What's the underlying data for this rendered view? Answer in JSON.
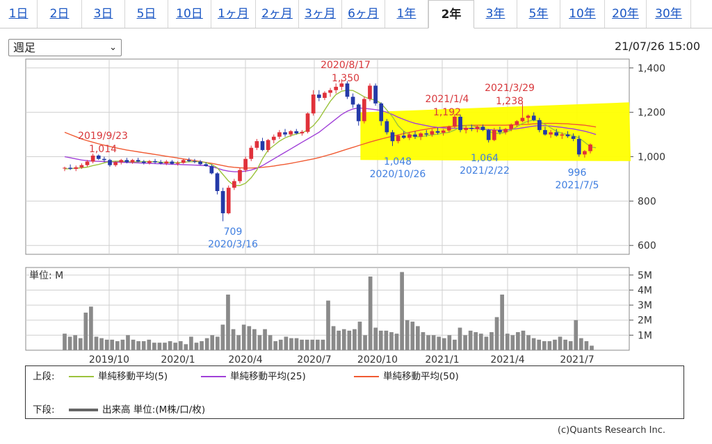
{
  "tabs": [
    {
      "label": "1日",
      "active": false
    },
    {
      "label": "2日",
      "active": false
    },
    {
      "label": "3日",
      "active": false
    },
    {
      "label": "5日",
      "active": false
    },
    {
      "label": "10日",
      "active": false
    },
    {
      "label": "1ヶ月",
      "active": false
    },
    {
      "label": "2ヶ月",
      "active": false
    },
    {
      "label": "3ヶ月",
      "active": false
    },
    {
      "label": "6ヶ月",
      "active": false
    },
    {
      "label": "1年",
      "active": false
    },
    {
      "label": "2年",
      "active": true
    },
    {
      "label": "3年",
      "active": false
    },
    {
      "label": "5年",
      "active": false
    },
    {
      "label": "10年",
      "active": false
    },
    {
      "label": "20年",
      "active": false
    },
    {
      "label": "30年",
      "active": false
    }
  ],
  "period_select": {
    "value": "週足"
  },
  "timestamp": "21/07/26 15:00",
  "colors": {
    "up": "#e0313a",
    "down": "#243aa8",
    "ma5": "#9cc33c",
    "ma25": "#a040d8",
    "ma50": "#f05a32",
    "volume": "#8a8a8a",
    "highlight": "#ffff00",
    "red_annotation": "#d8373b",
    "blue_annotation": "#3f7ee0",
    "tab_link": "#1a56c4"
  },
  "chart_data": [
    {
      "type": "candlestick",
      "title": "",
      "y_ticks": [
        "1,400",
        "1,200",
        "1,000",
        "800",
        "600"
      ],
      "ylim": [
        560,
        1440
      ],
      "x_ticks": [
        "2019/10",
        "2020/1",
        "2020/4",
        "2020/7",
        "2020/10",
        "2021/1",
        "2021/4",
        "2021/7"
      ],
      "y_axis_side": "right",
      "grid": true,
      "highlight_region": {
        "x_from": "2020/9",
        "x_to": "2021/7",
        "y_from": 980,
        "y_to": 1245
      },
      "annotations_red": [
        {
          "date": "2019/9/23",
          "value": "1,014"
        },
        {
          "date": "2020/8/17",
          "value": "1,350"
        },
        {
          "date": "2021/1/4",
          "value": "1,192"
        },
        {
          "date": "2021/3/29",
          "value": "1,238"
        }
      ],
      "annotations_blue": [
        {
          "date": "2020/3/16",
          "value": "709"
        },
        {
          "date": "2020/10/26",
          "value": "1,048"
        },
        {
          "date": "2021/2/22",
          "value": "1,064"
        },
        {
          "date": "2021/7/5",
          "value": "996"
        }
      ],
      "candles": [
        [
          948,
          955,
          935,
          950
        ],
        [
          950,
          965,
          940,
          945
        ],
        [
          945,
          960,
          935,
          952
        ],
        [
          952,
          970,
          945,
          962
        ],
        [
          962,
          985,
          955,
          978
        ],
        [
          978,
          1014,
          970,
          1005
        ],
        [
          1005,
          1010,
          985,
          990
        ],
        [
          990,
          1000,
          975,
          985
        ],
        [
          985,
          990,
          955,
          962
        ],
        [
          962,
          980,
          955,
          975
        ],
        [
          975,
          990,
          965,
          985
        ],
        [
          985,
          995,
          970,
          975
        ],
        [
          975,
          990,
          968,
          985
        ],
        [
          985,
          995,
          975,
          978
        ],
        [
          978,
          985,
          965,
          972
        ],
        [
          972,
          985,
          965,
          980
        ],
        [
          980,
          990,
          968,
          975
        ],
        [
          975,
          985,
          965,
          970
        ],
        [
          970,
          985,
          962,
          978
        ],
        [
          978,
          985,
          965,
          968
        ],
        [
          968,
          980,
          960,
          972
        ],
        [
          972,
          990,
          968,
          985
        ],
        [
          985,
          995,
          975,
          980
        ],
        [
          980,
          990,
          970,
          978
        ],
        [
          978,
          985,
          962,
          966
        ],
        [
          966,
          975,
          955,
          958
        ],
        [
          958,
          965,
          920,
          925
        ],
        [
          925,
          930,
          830,
          845
        ],
        [
          845,
          860,
          709,
          745
        ],
        [
          745,
          870,
          740,
          860
        ],
        [
          860,
          900,
          850,
          890
        ],
        [
          890,
          950,
          880,
          940
        ],
        [
          940,
          1000,
          930,
          990
        ],
        [
          990,
          1050,
          980,
          1040
        ],
        [
          1040,
          1080,
          1030,
          1070
        ],
        [
          1070,
          1085,
          1025,
          1030
        ],
        [
          1030,
          1080,
          1020,
          1075
        ],
        [
          1075,
          1100,
          1060,
          1090
        ],
        [
          1090,
          1120,
          1080,
          1110
        ],
        [
          1110,
          1125,
          1090,
          1100
        ],
        [
          1100,
          1120,
          1090,
          1115
        ],
        [
          1115,
          1125,
          1100,
          1105
        ],
        [
          1105,
          1120,
          1095,
          1112
        ],
        [
          1112,
          1200,
          1105,
          1195
        ],
        [
          1195,
          1300,
          1185,
          1280
        ],
        [
          1280,
          1300,
          1250,
          1265
        ],
        [
          1265,
          1295,
          1255,
          1288
        ],
        [
          1288,
          1310,
          1270,
          1300
        ],
        [
          1300,
          1330,
          1285,
          1315
        ],
        [
          1315,
          1350,
          1300,
          1330
        ],
        [
          1330,
          1340,
          1260,
          1270
        ],
        [
          1270,
          1285,
          1220,
          1235
        ],
        [
          1235,
          1240,
          1140,
          1160
        ],
        [
          1160,
          1270,
          1150,
          1260
        ],
        [
          1260,
          1330,
          1250,
          1320
        ],
        [
          1320,
          1330,
          1230,
          1240
        ],
        [
          1240,
          1245,
          1140,
          1160
        ],
        [
          1160,
          1170,
          1100,
          1110
        ],
        [
          1110,
          1120,
          1048,
          1070
        ],
        [
          1070,
          1100,
          1060,
          1095
        ],
        [
          1095,
          1115,
          1080,
          1085
        ],
        [
          1085,
          1110,
          1075,
          1100
        ],
        [
          1100,
          1115,
          1080,
          1090
        ],
        [
          1090,
          1110,
          1075,
          1105
        ],
        [
          1105,
          1120,
          1090,
          1100
        ],
        [
          1100,
          1125,
          1090,
          1115
        ],
        [
          1115,
          1130,
          1100,
          1108
        ],
        [
          1108,
          1125,
          1095,
          1118
        ],
        [
          1118,
          1140,
          1110,
          1135
        ],
        [
          1135,
          1192,
          1130,
          1180
        ],
        [
          1180,
          1190,
          1110,
          1120
        ],
        [
          1120,
          1140,
          1105,
          1130
        ],
        [
          1130,
          1145,
          1115,
          1125
        ],
        [
          1125,
          1140,
          1110,
          1135
        ],
        [
          1135,
          1145,
          1115,
          1120
        ],
        [
          1120,
          1125,
          1064,
          1075
        ],
        [
          1075,
          1130,
          1070,
          1120
        ],
        [
          1120,
          1135,
          1100,
          1110
        ],
        [
          1110,
          1130,
          1100,
          1125
        ],
        [
          1125,
          1150,
          1115,
          1145
        ],
        [
          1145,
          1165,
          1135,
          1160
        ],
        [
          1160,
          1238,
          1155,
          1175
        ],
        [
          1175,
          1190,
          1150,
          1185
        ],
        [
          1185,
          1200,
          1160,
          1165
        ],
        [
          1165,
          1175,
          1110,
          1120
        ],
        [
          1120,
          1135,
          1095,
          1100
        ],
        [
          1100,
          1120,
          1085,
          1110
        ],
        [
          1110,
          1125,
          1090,
          1095
        ],
        [
          1095,
          1110,
          1080,
          1100
        ],
        [
          1100,
          1115,
          1085,
          1092
        ],
        [
          1092,
          1105,
          1070,
          1080
        ],
        [
          1080,
          1095,
          1000,
          1010
        ],
        [
          1010,
          1030,
          996,
          1025
        ],
        [
          1025,
          1060,
          1015,
          1055
        ]
      ],
      "ma5": [
        945,
        946,
        948,
        950,
        953,
        960,
        965,
        972,
        978,
        980,
        980,
        978,
        976,
        977,
        978,
        978,
        977,
        975,
        974,
        974,
        973,
        975,
        977,
        978,
        977,
        973,
        965,
        950,
        920,
        890,
        870,
        870,
        880,
        905,
        940,
        990,
        1030,
        1050,
        1070,
        1085,
        1095,
        1102,
        1108,
        1120,
        1140,
        1170,
        1210,
        1250,
        1280,
        1295,
        1300,
        1298,
        1285,
        1270,
        1260,
        1255,
        1240,
        1210,
        1180,
        1140,
        1115,
        1100,
        1090,
        1090,
        1095,
        1098,
        1102,
        1106,
        1110,
        1120,
        1135,
        1140,
        1140,
        1135,
        1130,
        1115,
        1105,
        1105,
        1110,
        1120,
        1135,
        1150,
        1160,
        1165,
        1160,
        1145,
        1130,
        1115,
        1105,
        1100,
        1095,
        1085,
        1065,
        1045,
        1040
      ],
      "ma25": [
        1000,
        995,
        990,
        985,
        982,
        980,
        979,
        978,
        977,
        976,
        975,
        974,
        973,
        972,
        971,
        970,
        969,
        968,
        967,
        966,
        965,
        964,
        963,
        962,
        961,
        960,
        955,
        948,
        940,
        935,
        932,
        932,
        935,
        940,
        948,
        960,
        975,
        990,
        1005,
        1020,
        1035,
        1050,
        1065,
        1080,
        1095,
        1110,
        1130,
        1150,
        1170,
        1190,
        1205,
        1215,
        1220,
        1218,
        1215,
        1212,
        1208,
        1200,
        1190,
        1178,
        1168,
        1158,
        1150,
        1145,
        1140,
        1135,
        1132,
        1130,
        1128,
        1128,
        1128,
        1128,
        1127,
        1126,
        1124,
        1122,
        1120,
        1120,
        1121,
        1123,
        1126,
        1130,
        1134,
        1138,
        1140,
        1140,
        1138,
        1135,
        1132,
        1128,
        1125,
        1120,
        1115,
        1108,
        1100
      ],
      "ma50": [
        1110,
        1100,
        1090,
        1080,
        1072,
        1065,
        1058,
        1052,
        1046,
        1040,
        1035,
        1030,
        1026,
        1022,
        1018,
        1014,
        1010,
        1006,
        1002,
        998,
        994,
        990,
        986,
        982,
        978,
        974,
        970,
        965,
        960,
        955,
        952,
        950,
        949,
        949,
        950,
        952,
        955,
        958,
        962,
        966,
        970,
        975,
        980,
        985,
        990,
        996,
        1003,
        1010,
        1018,
        1026,
        1034,
        1042,
        1050,
        1058,
        1066,
        1073,
        1080,
        1086,
        1092,
        1098,
        1104,
        1110,
        1115,
        1120,
        1124,
        1128,
        1131,
        1134,
        1136,
        1138,
        1140,
        1141,
        1142,
        1142,
        1142,
        1142,
        1142,
        1142,
        1142,
        1143,
        1144,
        1145,
        1146,
        1148,
        1149,
        1150,
        1150,
        1150,
        1149,
        1148,
        1146,
        1144,
        1142,
        1138,
        1134
      ]
    },
    {
      "type": "bar",
      "title": "",
      "unit_label": "単位: M",
      "y_ticks": [
        "5M",
        "4M",
        "3M",
        "2M",
        "1M"
      ],
      "ylim": [
        0,
        5.5
      ],
      "x_ticks": [
        "2019/10",
        "2020/1",
        "2020/4",
        "2020/7",
        "2020/10",
        "2021/1",
        "2021/4",
        "2021/7"
      ],
      "values": [
        1.1,
        0.9,
        1.0,
        0.8,
        2.5,
        2.9,
        0.9,
        0.8,
        0.7,
        0.7,
        0.6,
        0.7,
        1.0,
        0.7,
        0.6,
        0.6,
        0.7,
        0.5,
        0.5,
        0.5,
        0.6,
        0.5,
        0.6,
        0.4,
        0.9,
        0.5,
        0.6,
        0.8,
        1.0,
        0.9,
        1.7,
        3.7,
        1.4,
        1.0,
        1.7,
        1.6,
        1.4,
        1.0,
        1.4,
        1.0,
        0.6,
        0.7,
        0.9,
        0.8,
        0.8,
        0.7,
        0.7,
        0.7,
        0.7,
        0.7,
        3.3,
        1.6,
        1.3,
        1.4,
        1.3,
        1.4,
        1.9,
        1.0,
        4.9,
        1.5,
        1.3,
        1.3,
        1.2,
        1.1,
        5.2,
        2.0,
        1.9,
        1.6,
        1.2,
        1.0,
        1.0,
        0.9,
        0.8,
        1.0,
        0.7,
        1.5,
        1.0,
        1.3,
        1.2,
        1.1,
        0.9,
        1.2,
        2.2,
        3.7,
        1.1,
        1.0,
        1.2,
        1.3,
        1.0,
        0.8,
        0.7,
        0.6,
        0.6,
        0.7,
        0.9,
        0.7,
        0.6,
        2.0,
        0.8,
        0.6,
        0.3
      ]
    }
  ],
  "legend": {
    "upper_label": "上段:",
    "ma5_label": "単純移動平均(5)",
    "ma25_label": "単純移動平均(25)",
    "ma50_label": "単純移動平均(50)",
    "lower_label": "下段:",
    "volume_label": "出来高 単位:(M株/口/枚)"
  },
  "copyright": "(c)Quants Research Inc."
}
